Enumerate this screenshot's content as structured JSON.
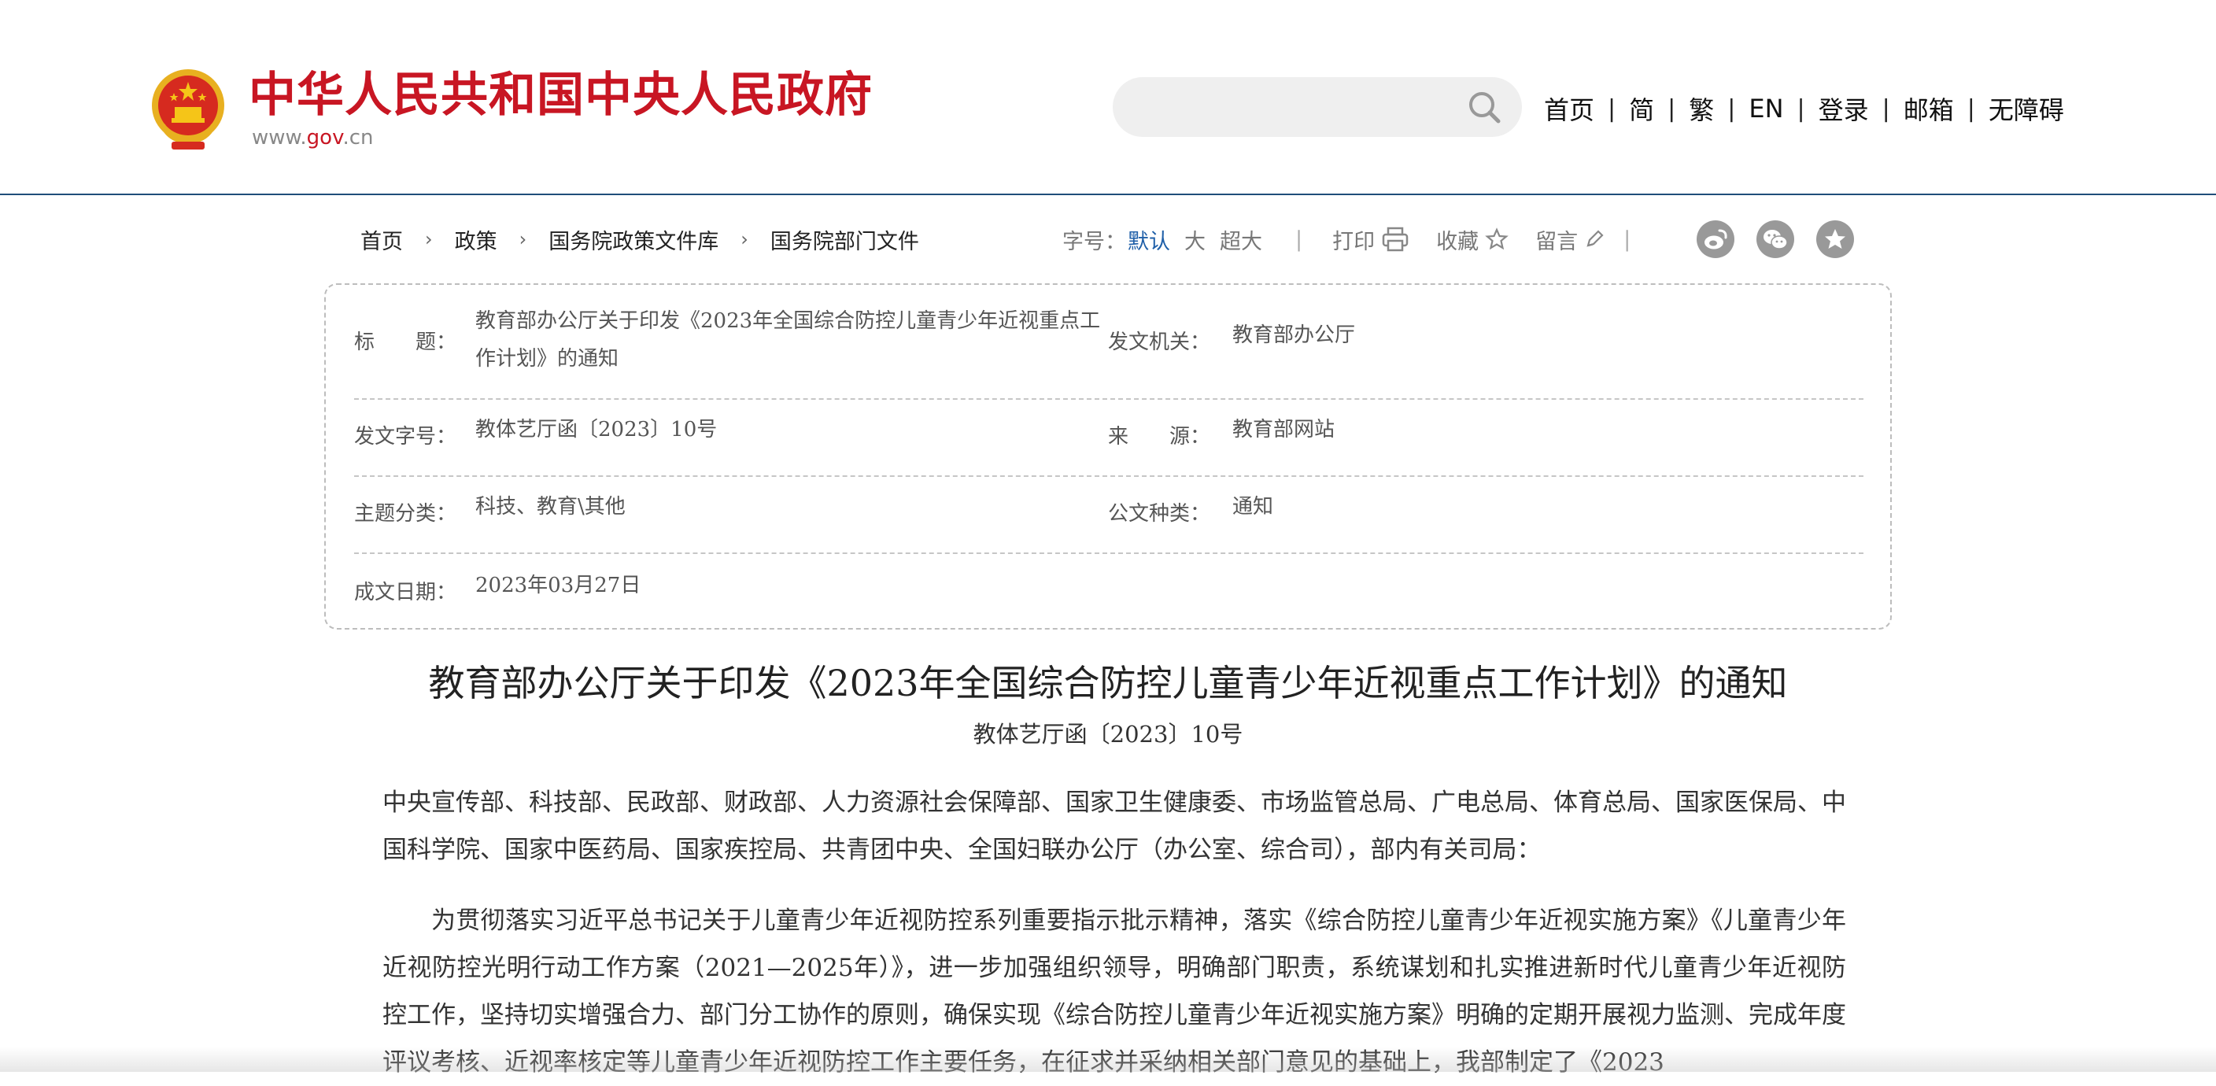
{
  "header": {
    "site_title": "中华人民共和国中央人民政府",
    "site_url_prefix": "www.",
    "site_url_accent": "gov",
    "site_url_suffix": ".cn",
    "search_placeholder": "",
    "nav": [
      {
        "label": "首页"
      },
      {
        "label": "简"
      },
      {
        "label": "繁"
      },
      {
        "label": "EN"
      },
      {
        "label": "登录"
      },
      {
        "label": "邮箱"
      },
      {
        "label": "无障碍"
      }
    ],
    "nav_separator": "|"
  },
  "breadcrumb": {
    "items": [
      "首页",
      "政策",
      "国务院政策文件库",
      "国务院部门文件"
    ],
    "separator": "›"
  },
  "toolbar": {
    "font_size_label": "字号：",
    "font_sizes": [
      "默认",
      "大",
      "超大"
    ],
    "active_font_size": "默认",
    "separator": "|",
    "print": "打印",
    "favorite": "收藏",
    "comment": "留言",
    "share_icons": [
      "weibo-icon",
      "wechat-icon",
      "qzone-icon"
    ]
  },
  "metadata": {
    "title_label": "标　　题：",
    "title_value": "教育部办公厅关于印发《2023年全国综合防控儿童青少年近视重点工作计划》的通知",
    "issuer_label": "发文机关：",
    "issuer_value": "教育部办公厅",
    "doc_no_label": "发文字号：",
    "doc_no_value": "教体艺厅函〔2023〕10号",
    "source_label": "来　　源：",
    "source_value": "教育部网站",
    "topic_label": "主题分类：",
    "topic_value": "科技、教育\\其他",
    "type_label": "公文种类：",
    "type_value": "通知",
    "date_label": "成文日期：",
    "date_value": "2023年03月27日"
  },
  "article": {
    "title": "教育部办公厅关于印发《2023年全国综合防控儿童青少年近视重点工作计划》的通知",
    "doc_number": "教体艺厅函〔2023〕10号",
    "recipients": "中央宣传部、科技部、民政部、财政部、人力资源社会保障部、国家卫生健康委、市场监管总局、广电总局、体育总局、国家医保局、中国科学院、国家中医药局、国家疾控局、共青团中央、全国妇联办公厅（办公室、综合司），部内有关司局：",
    "paragraph1": "为贯彻落实习近平总书记关于儿童青少年近视防控系列重要指示批示精神，落实《综合防控儿童青少年近视实施方案》《儿童青少年近视防控光明行动工作方案（2021—2025年）》，进一步加强组织领导，明确部门职责，系统谋划和扎实推进新时代儿童青少年近视防控工作，坚持切实增强合力、部门分工协作的原则，确保实现《综合防控儿童青少年近视实施方案》明确的定期开展视力监测、完成年度评议考核、近视率核定等儿童青少年近视防控工作主要任务，在征求并采纳相关部门意见的基础上，我部制定了《2023"
  },
  "colors": {
    "brand_red": "#c81623",
    "link_blue": "#1f5fa8",
    "header_border": "#1f4e79"
  }
}
